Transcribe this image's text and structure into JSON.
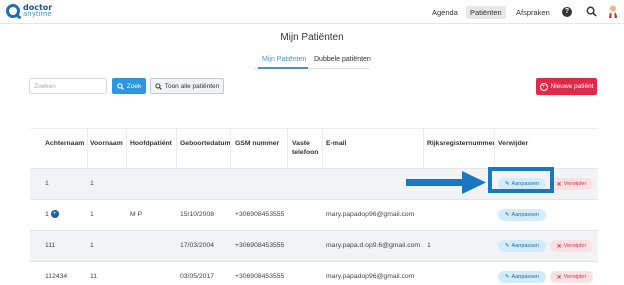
{
  "brand": {
    "line1": "doctor",
    "line2": "anytime"
  },
  "nav": {
    "items": [
      "Agenda",
      "Patiënten",
      "Afspraken"
    ],
    "help_glyph": "?",
    "icons": [
      "help-icon",
      "search-icon",
      "avatar"
    ]
  },
  "page": {
    "title": "Mijn Patiënten"
  },
  "tabs": [
    "Mijn Patiënten",
    "Dubbele patiënten"
  ],
  "toolbar": {
    "search_placeholder": "Zoeken",
    "search_button": "Zoek",
    "show_all_button": "Toon alle patiënten",
    "new_patient_button": "Nieuwe patiënt"
  },
  "table": {
    "headers": {
      "achternaam": "Achternaam",
      "voornaam": "Voornaam",
      "hoofdpatient": "Hoofdpatiënt",
      "geboortedatum": "Geboortedatum",
      "gsm": "GSM nummer",
      "vaste_1": "Vaste",
      "vaste_2": "telefoon",
      "email": "E-mail",
      "rijks": "Rijksregisternummer",
      "verwijder": "Verwijder"
    },
    "rows": [
      {
        "achternaam": "1",
        "voornaam": "1",
        "hoofdpatient": "",
        "geboortedatum": "",
        "gsm": "",
        "vaste": "",
        "email": "",
        "rijks": "",
        "edit": "Aanpassen",
        "delete": "Verwijder"
      },
      {
        "achternaam": "1",
        "voornaam": "1",
        "hoofdpatient": "M P",
        "geboortedatum": "15/10/2008",
        "gsm": "+306908453555",
        "vaste": "",
        "email": "mary.papadop96@gmail.com",
        "rijks": "",
        "edit": "Aanpassen",
        "delete": ""
      },
      {
        "achternaam": "111",
        "voornaam": "1",
        "hoofdpatient": "",
        "geboortedatum": "17/03/2004",
        "gsm": "+306908453555",
        "vaste": "",
        "email": "mary.papa.d.op9.6@gmail.com",
        "rijks": "1",
        "edit": "Aanpassen",
        "delete": "Verwijder"
      },
      {
        "achternaam": "112434",
        "voornaam": "11",
        "hoofdpatient": "",
        "geboortedatum": "03/05/2017",
        "gsm": "+306908453555",
        "vaste": "",
        "email": "mary.papadop96@gmail.com",
        "rijks": "",
        "edit": "Aanpassen",
        "delete": "Verwijder"
      }
    ]
  },
  "colors": {
    "primary": "#2d96e0",
    "danger": "#e2294a",
    "annotation": "#1a78c2"
  }
}
